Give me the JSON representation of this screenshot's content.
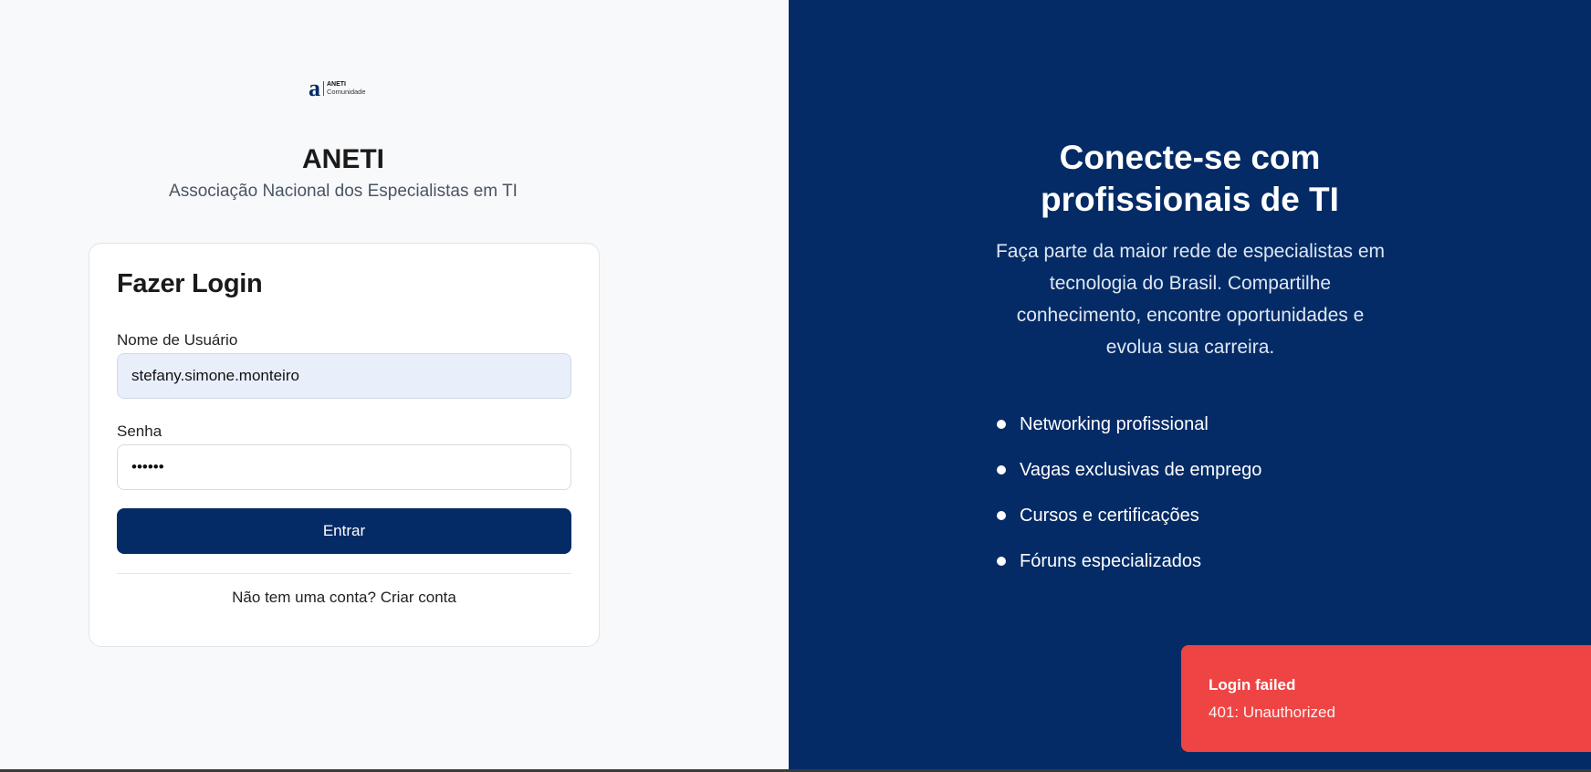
{
  "logo": {
    "mark": "a",
    "line1": "ANETI",
    "line2": "Comunidade"
  },
  "brand": {
    "title": "ANETI",
    "subtitle": "Associação Nacional dos Especialistas em TI"
  },
  "login": {
    "title": "Fazer Login",
    "username_label": "Nome de Usuário",
    "username_value": "stefany.simone.monteiro",
    "password_label": "Senha",
    "password_value": "••••••",
    "submit_label": "Entrar",
    "signup_prompt": "Não tem uma conta?",
    "signup_link": "Criar conta"
  },
  "hero": {
    "title_line1": "Conecte-se com",
    "title_line2": "profissionais de TI",
    "description": "Faça parte da maior rede de especialistas em tecnologia do Brasil. Compartilhe conhecimento, encontre oportunidades e evolua sua carreira.",
    "features": [
      "Networking profissional",
      "Vagas exclusivas de emprego",
      "Cursos e certificações",
      "Fóruns especializados"
    ]
  },
  "toast": {
    "title": "Login failed",
    "message": "401: Unauthorized"
  },
  "colors": {
    "primary": "#042b66",
    "error": "#ef4444",
    "background": "#f8f9fb"
  }
}
